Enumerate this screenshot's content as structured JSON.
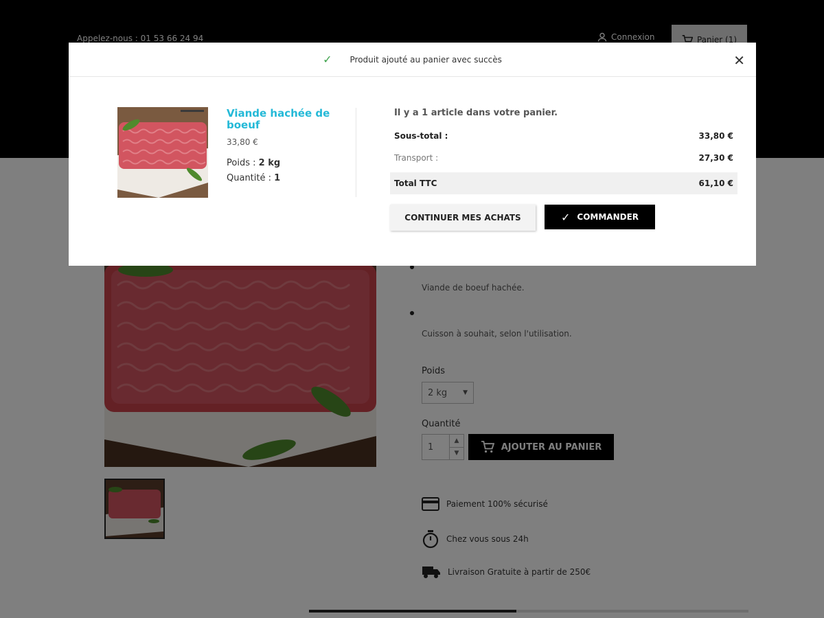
{
  "header": {
    "contact": "Appelez-nous : 01 53 66 24 94",
    "login_label": "Connexion",
    "cart_label": "Panier (1)"
  },
  "product": {
    "features": [
      "Viande de boeuf hachée.",
      "Cuisson à souhait,  selon l'utilisation."
    ],
    "weight_label": "Poids",
    "weight_value": "2 kg",
    "quantity_label": "Quantité",
    "quantity_value": "1",
    "add_to_cart_label": "AJOUTER AU PANIER"
  },
  "reassurance": [
    {
      "icon": "credit-card-icon",
      "text": "Paiement 100% sécurisé"
    },
    {
      "icon": "stopwatch-icon",
      "text": "Chez vous sous 24h"
    },
    {
      "icon": "truck-icon",
      "text": "Livraison Gratuite à partir de 250€"
    }
  ],
  "modal": {
    "title": "Produit ajouté au panier avec succès",
    "product_name": "Viande hachée de boeuf",
    "product_price": "33,80 €",
    "weight_label": "Poids : ",
    "weight_value": "2 kg",
    "quantity_label": "Quantité : ",
    "quantity_value": "1",
    "cart_count_text": "Il y a 1 article dans votre panier.",
    "subtotal_label": "Sous-total :",
    "subtotal_value": "33,80 €",
    "shipping_label": "Transport :",
    "shipping_value": "27,30 €",
    "total_label": "Total TTC",
    "total_value": "61,10 €",
    "continue_label": "CONTINUER MES ACHATS",
    "order_label": "COMMANDER"
  },
  "colors": {
    "accent": "#24b9d7",
    "success": "#3fa34d",
    "primary_button": "#000000"
  }
}
